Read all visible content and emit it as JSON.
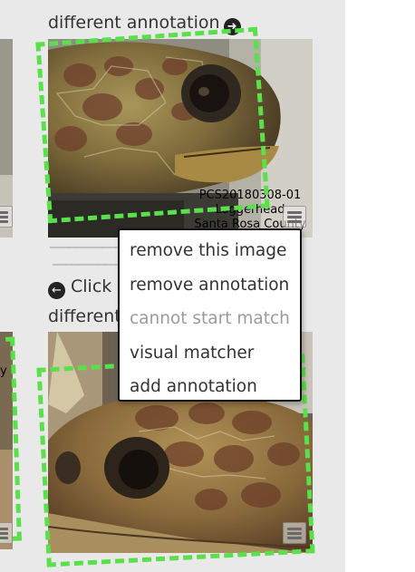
{
  "captions": {
    "top": "different annotation",
    "middle_part1": "Click a",
    "middle_part2": "different"
  },
  "image1_overlay": {
    "line1": "PCS20180308-01",
    "line2": "Loggerhead",
    "line3": "Santa Rosa County"
  },
  "image2_overlay": {
    "line1": "y"
  },
  "left_column_overlay": {
    "line1": "y"
  },
  "context_menu": {
    "items": [
      {
        "label": "remove this image",
        "enabled": true
      },
      {
        "label": "remove annotation",
        "enabled": true
      },
      {
        "label": "cannot start match",
        "enabled": false
      },
      {
        "label": "visual matcher",
        "enabled": true
      },
      {
        "label": "add annotation",
        "enabled": true
      }
    ]
  },
  "colors": {
    "annotation_box": "#59e04a",
    "panel_background": "#e9e9e9",
    "menu_border": "#111111",
    "disabled_text": "#9b9b9b"
  },
  "icons": [
    "circle-arrow-right-icon",
    "circle-arrow-left-icon",
    "hamburger-menu-icon"
  ]
}
